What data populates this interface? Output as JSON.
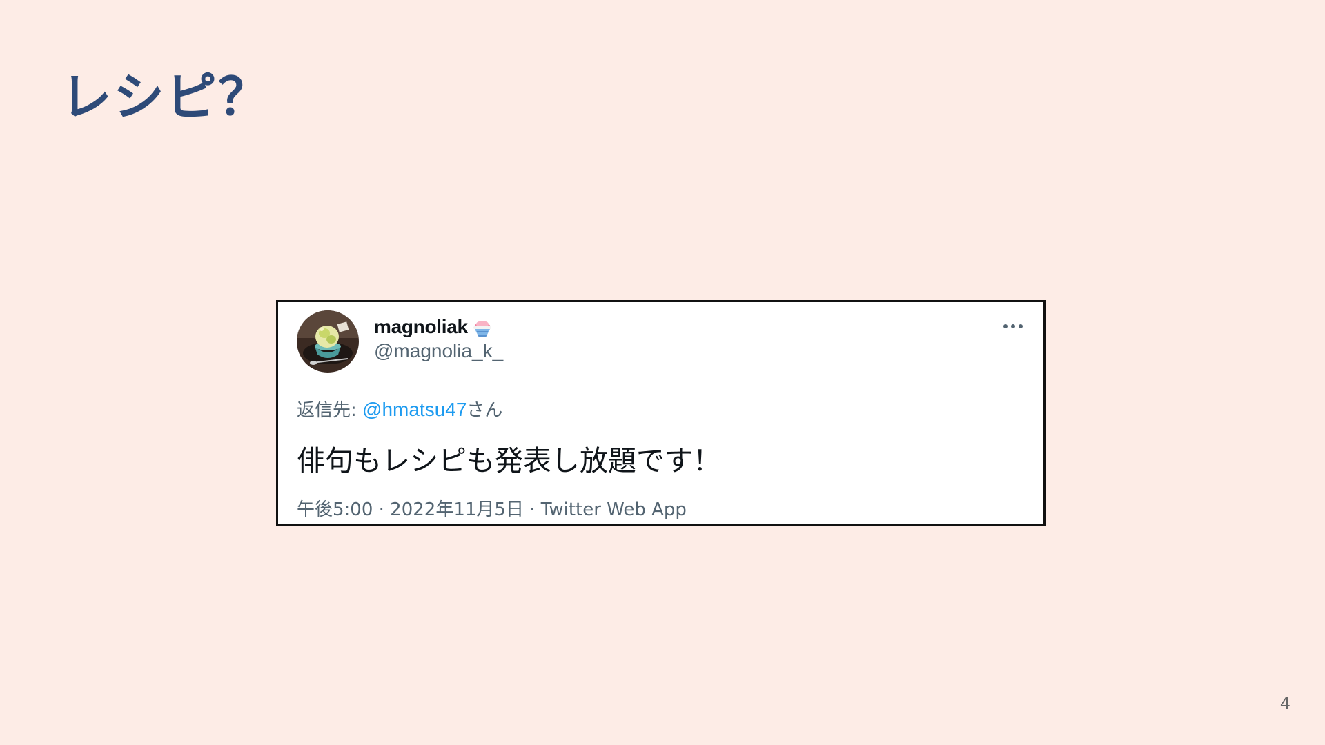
{
  "slide": {
    "title": "レシピ？",
    "page_number": "4"
  },
  "tweet": {
    "user_name": "magnoliak",
    "user_emoji": "shaved-ice-icon",
    "handle": "@magnolia_k_",
    "more_icon": "more-options-icon",
    "reply_prefix": "返信先: ",
    "reply_mention": "@hmatsu47",
    "reply_suffix": "さん",
    "text": "俳句もレシピも発表し放題です！",
    "meta": "午後5:00 · 2022年11月5日 · Twitter Web App"
  },
  "colors": {
    "background": "#fdece6",
    "title": "#2e4a78",
    "mention": "#1d9bf0",
    "secondary_text": "#536471"
  }
}
